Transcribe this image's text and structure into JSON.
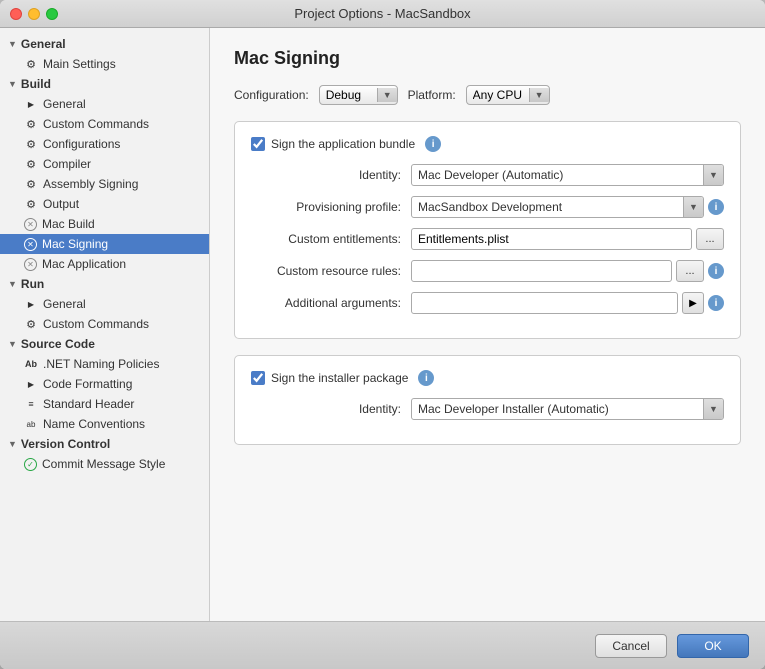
{
  "window": {
    "title": "Project Options - MacSandbox"
  },
  "sidebar": {
    "sections": [
      {
        "id": "general",
        "label": "General",
        "expanded": true,
        "items": [
          {
            "id": "main-settings",
            "label": "Main Settings",
            "icon": "gear",
            "active": false
          }
        ]
      },
      {
        "id": "build",
        "label": "Build",
        "expanded": true,
        "items": [
          {
            "id": "general",
            "label": "General",
            "icon": "arrow-right",
            "active": false
          },
          {
            "id": "custom-commands",
            "label": "Custom Commands",
            "icon": "gear",
            "active": false
          },
          {
            "id": "configurations",
            "label": "Configurations",
            "icon": "gear",
            "active": false
          },
          {
            "id": "compiler",
            "label": "Compiler",
            "icon": "gear",
            "active": false
          },
          {
            "id": "assembly-signing",
            "label": "Assembly Signing",
            "icon": "gear",
            "active": false
          },
          {
            "id": "output",
            "label": "Output",
            "icon": "gear",
            "active": false
          },
          {
            "id": "mac-build",
            "label": "Mac Build",
            "icon": "x-circle",
            "active": false
          },
          {
            "id": "mac-signing",
            "label": "Mac Signing",
            "icon": "x-circle",
            "active": true
          },
          {
            "id": "mac-application",
            "label": "Mac Application",
            "icon": "x-circle",
            "active": false
          }
        ]
      },
      {
        "id": "run",
        "label": "Run",
        "expanded": true,
        "items": [
          {
            "id": "run-general",
            "label": "General",
            "icon": "arrow-right",
            "active": false
          },
          {
            "id": "run-custom-commands",
            "label": "Custom Commands",
            "icon": "gear",
            "active": false
          }
        ]
      },
      {
        "id": "source-code",
        "label": "Source Code",
        "expanded": true,
        "items": [
          {
            "id": "net-naming",
            "label": ".NET Naming Policies",
            "icon": "ab",
            "active": false
          },
          {
            "id": "code-formatting",
            "label": "Code Formatting",
            "icon": "arrow-right",
            "active": false
          },
          {
            "id": "standard-header",
            "label": "Standard Header",
            "icon": "lines",
            "active": false
          },
          {
            "id": "name-conventions",
            "label": "Name Conventions",
            "icon": "ab-small",
            "active": false
          }
        ]
      },
      {
        "id": "version-control",
        "label": "Version Control",
        "expanded": true,
        "items": [
          {
            "id": "commit-message",
            "label": "Commit Message Style",
            "icon": "check-circle",
            "active": false
          }
        ]
      }
    ]
  },
  "main": {
    "title": "Mac Signing",
    "config_label": "Configuration:",
    "config_value": "Debug",
    "platform_label": "Platform:",
    "platform_value": "Any CPU",
    "sign_bundle_label": "Sign the application bundle",
    "identity_label": "Identity:",
    "identity_value": "Mac Developer (Automatic)",
    "provisioning_label": "Provisioning profile:",
    "provisioning_value": "MacSandbox Development",
    "custom_entitlements_label": "Custom entitlements:",
    "custom_entitlements_value": "Entitlements.plist",
    "custom_resource_label": "Custom resource rules:",
    "custom_resource_value": "",
    "additional_args_label": "Additional arguments:",
    "additional_args_value": "",
    "sign_installer_label": "Sign the installer package",
    "installer_identity_label": "Identity:",
    "installer_identity_value": "Mac Developer Installer (Automatic)"
  },
  "footer": {
    "cancel_label": "Cancel",
    "ok_label": "OK"
  }
}
